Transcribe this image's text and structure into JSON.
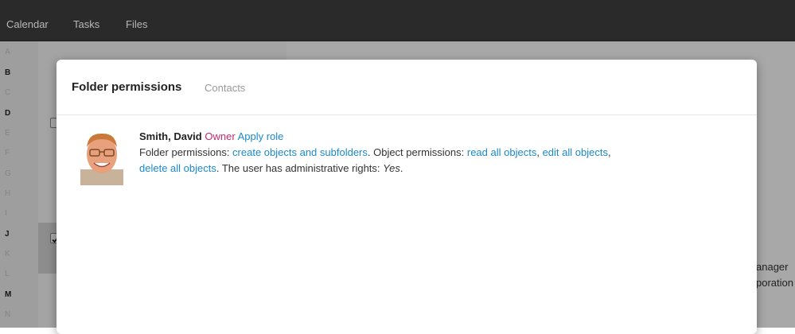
{
  "topbar": {
    "items": [
      "Calendar",
      "Tasks",
      "Files"
    ]
  },
  "alpha_index": {
    "letters": [
      "A",
      "B",
      "C",
      "D",
      "E",
      "F",
      "G",
      "H",
      "I",
      "J",
      "K",
      "L",
      "M",
      "N"
    ],
    "bold": [
      "B",
      "D",
      "J",
      "M"
    ]
  },
  "background": {
    "detail_line_1": "anager",
    "detail_line_2": "poration"
  },
  "modal": {
    "title": "Folder permissions",
    "subtitle": "Contacts",
    "entry": {
      "name": "Smith, David",
      "role": "Owner",
      "apply_role": "Apply role",
      "folder_perms_label": "Folder permissions: ",
      "folder_perms_value": "create objects and subfolders",
      "object_perms_label": ". Object permissions: ",
      "read_value": "read all objects",
      "sep": ", ",
      "edit_value": "edit all objects",
      "sep2": ",",
      "delete_value": "delete all objects",
      "admin_label": ". The user has administrative rights: ",
      "admin_value": "Yes",
      "end": "."
    }
  },
  "colors": {
    "topbar_bg": "#2a2a2a",
    "link": "#1a8acb",
    "owner_badge": "#c42a72",
    "title": "#222222",
    "subtitle": "#999999"
  }
}
